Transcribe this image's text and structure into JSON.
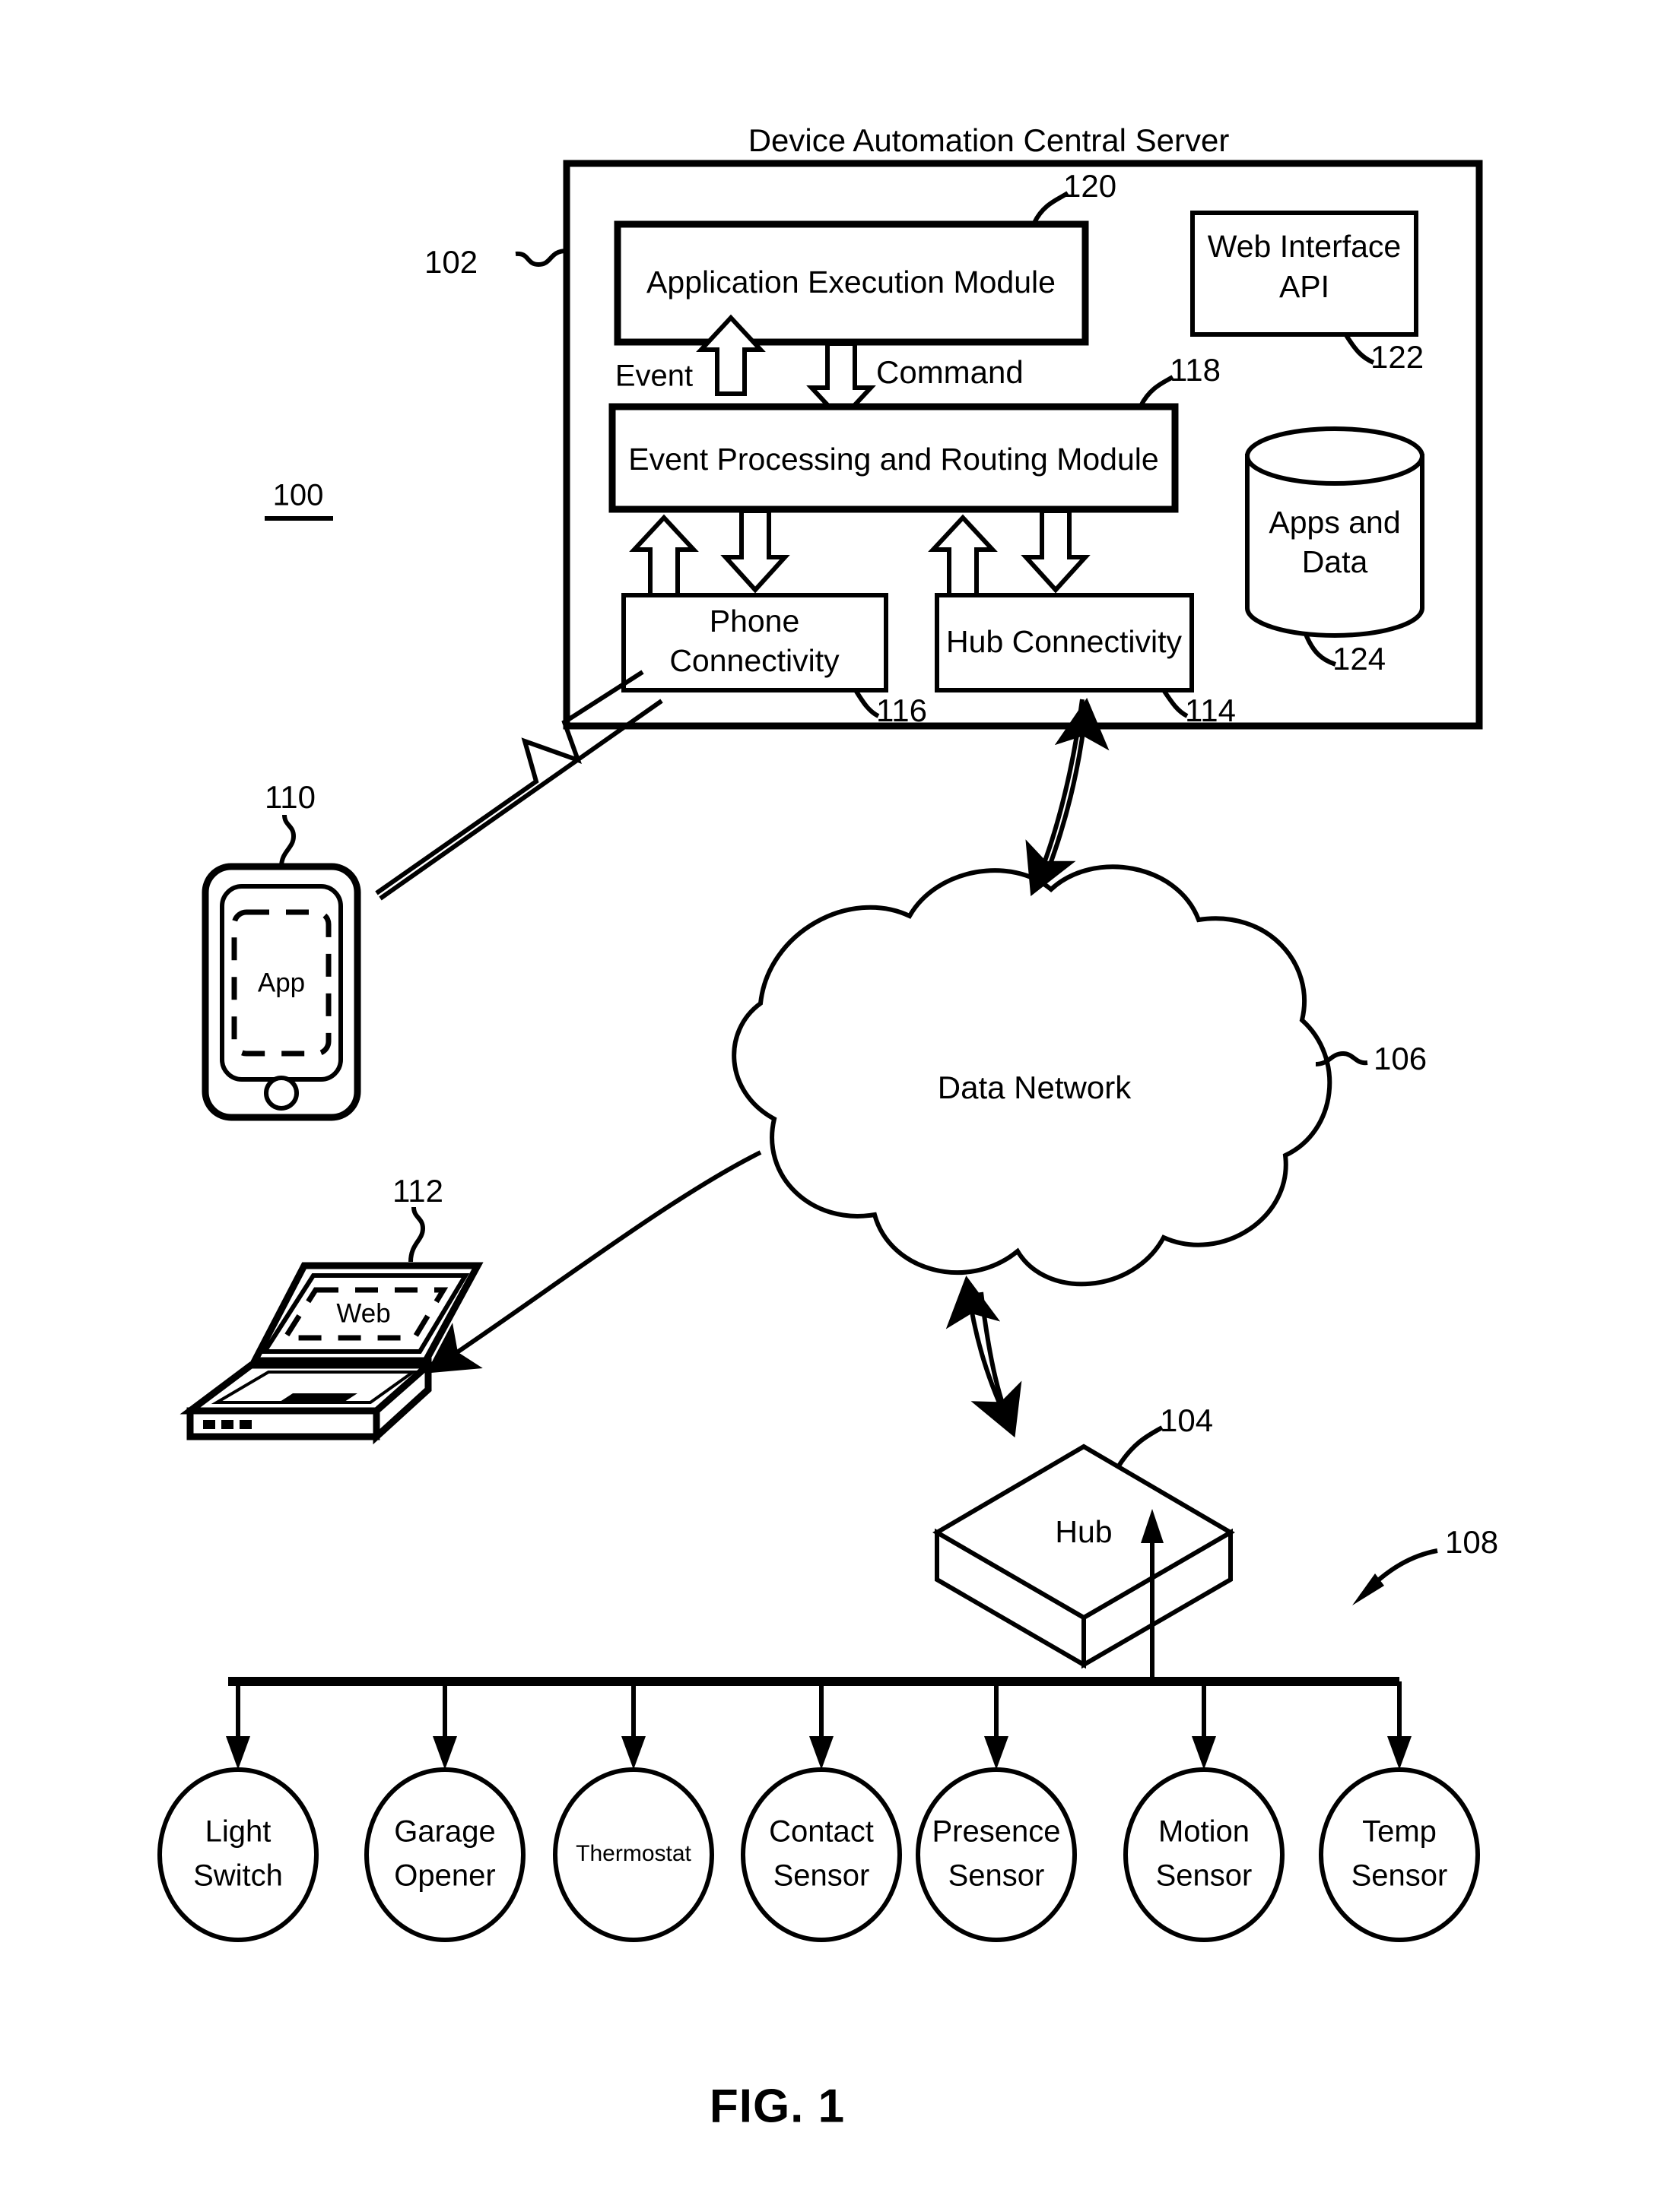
{
  "figure": {
    "caption": "FIG. 1",
    "system_ref": "100"
  },
  "server": {
    "title": "Device Automation Central Server",
    "ref": "102",
    "modules": [
      {
        "label": "Application Execution Module",
        "ref": "120"
      },
      {
        "label": "Event Processing and Routing Module",
        "ref": "118"
      },
      {
        "label_line1": "Phone",
        "label_line2": "Connectivity",
        "ref": "116"
      },
      {
        "label": "Hub Connectivity",
        "ref": "114"
      }
    ],
    "web_api": {
      "label_line1": "Web Interface",
      "label_line2": "API",
      "ref": "122"
    },
    "storage": {
      "label_line1": "Apps and",
      "label_line2": "Data",
      "ref": "124"
    },
    "flow_labels": {
      "event": "Event",
      "command": "Command"
    }
  },
  "clients": {
    "phone": {
      "screen_label": "App",
      "ref": "110"
    },
    "laptop": {
      "screen_label": "Web",
      "ref": "112"
    }
  },
  "network": {
    "cloud_label": "Data Network",
    "ref": "106"
  },
  "hub": {
    "label": "Hub",
    "ref": "104"
  },
  "devices": {
    "group_ref": "108",
    "items": [
      {
        "line1": "Light",
        "line2": "Switch",
        "single_line": false
      },
      {
        "line1": "Garage",
        "line2": "Opener",
        "single_line": false
      },
      {
        "line1": "Thermostat",
        "line2": "",
        "single_line": true
      },
      {
        "line1": "Contact",
        "line2": "Sensor",
        "single_line": false
      },
      {
        "line1": "Presence",
        "line2": "Sensor",
        "single_line": false
      },
      {
        "line1": "Motion",
        "line2": "Sensor",
        "single_line": false
      },
      {
        "line1": "Temp",
        "line2": "Sensor",
        "single_line": false
      }
    ]
  },
  "colors": {
    "ink": "#000000",
    "paper": "#ffffff"
  }
}
